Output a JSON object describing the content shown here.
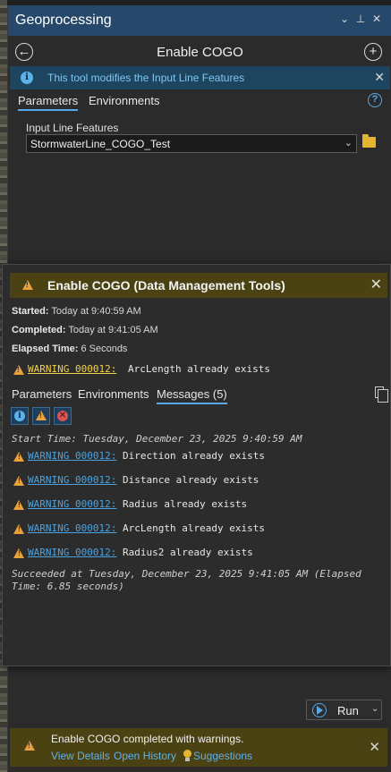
{
  "pane": {
    "title": "Geoprocessing",
    "controls": {
      "menu": "⌄",
      "pin": "⊥",
      "close": "✕"
    },
    "back_glyph": "←",
    "add_glyph": "+",
    "tool_title": "Enable COGO"
  },
  "info_banner": {
    "icon": "i",
    "text": "This tool modifies the Input Line Features",
    "close": "✕"
  },
  "tabs": [
    {
      "label": "Parameters",
      "active": true
    },
    {
      "label": "Environments",
      "active": false
    }
  ],
  "help_glyph": "?",
  "parameter": {
    "label": "Input Line Features",
    "value": "StormwaterLine_COGO_Test",
    "chevron": "⌄"
  },
  "popup": {
    "title": "Enable COGO (Data Management Tools)",
    "close": "✕",
    "started_label": "Started:",
    "started_value": "Today at 9:40:59 AM",
    "completed_label": "Completed:",
    "completed_value": "Today at 9:41:05 AM",
    "elapsed_label": "Elapsed Time:",
    "elapsed_value": "6 Seconds",
    "main_warning": {
      "code": "WARNING 000012:",
      "text": "ArcLength already exists"
    },
    "tabs": [
      {
        "label": "Parameters",
        "active": false
      },
      {
        "label": "Environments",
        "active": false
      },
      {
        "label": "Messages (5)",
        "active": true
      }
    ],
    "filters": {
      "info": "i",
      "error": "✕"
    },
    "start_time": "Start Time: Tuesday, December 23, 2025 9:40:59 AM",
    "messages": [
      {
        "code": "WARNING 000012:",
        "text": "Direction already exists"
      },
      {
        "code": "WARNING 000012:",
        "text": "Distance already exists"
      },
      {
        "code": "WARNING 000012:",
        "text": "Radius already exists"
      },
      {
        "code": "WARNING 000012:",
        "text": "ArcLength already exists"
      },
      {
        "code": "WARNING 000012:",
        "text": "Radius2 already exists"
      }
    ],
    "succeeded": "Succeeded at Tuesday, December 23, 2025 9:41:05 AM (Elapsed Time: 6.85 seconds)"
  },
  "run_button": {
    "label": "Run",
    "chevron": "⌄"
  },
  "status_bar": {
    "message": "Enable COGO completed with warnings.",
    "view_details": "View Details",
    "open_history": "Open History",
    "suggestions": "Suggestions",
    "close": "✕"
  },
  "colors": {
    "header_blue": "#26496b",
    "warning_bar": "#4a4213",
    "warning_icon": "#e9a13b",
    "link_blue": "#4aa3e0"
  }
}
